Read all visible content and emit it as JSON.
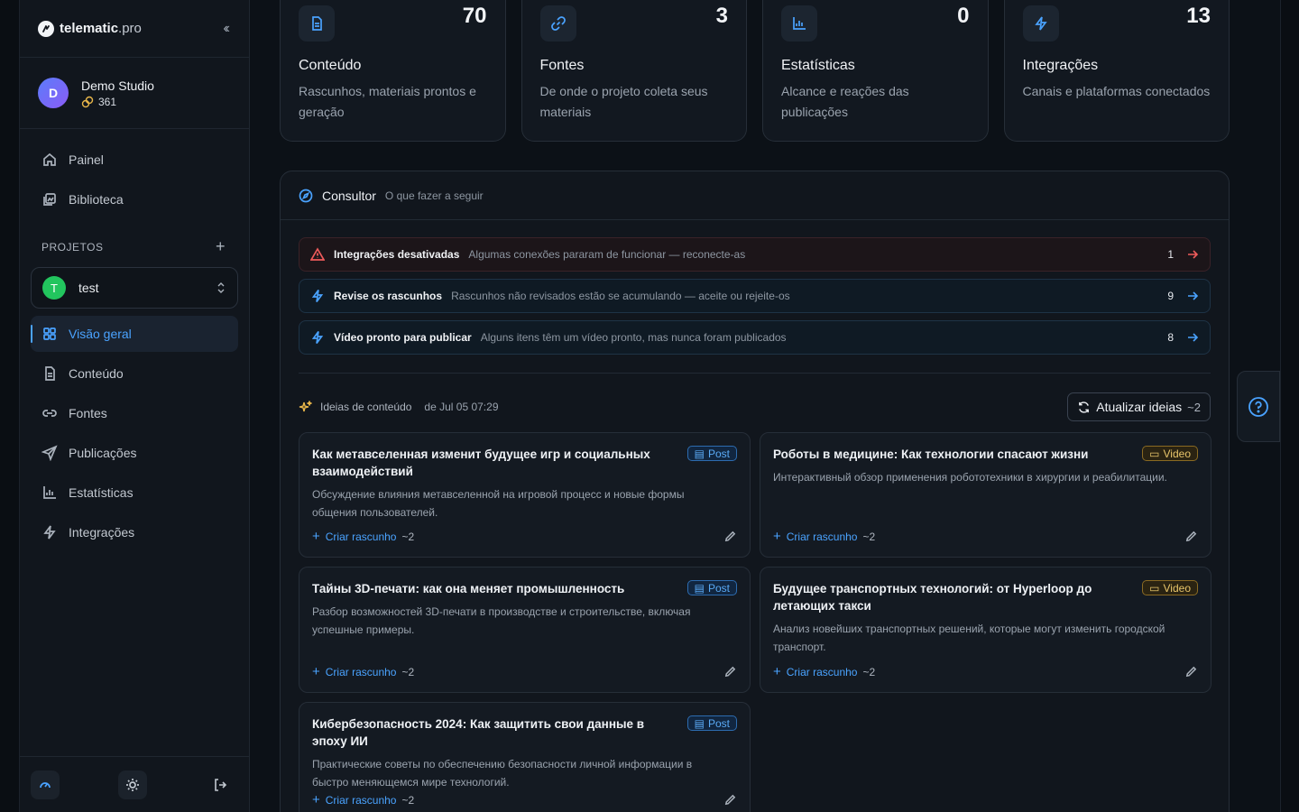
{
  "brand": {
    "name": "telematic",
    "suffix": ".pro"
  },
  "account": {
    "initial": "D",
    "name": "Demo Studio",
    "credits": "361"
  },
  "nav": {
    "top": [
      {
        "label": "Painel",
        "icon": "home-icon"
      },
      {
        "label": "Biblioteca",
        "icon": "library-icon"
      }
    ],
    "projects_label": "PROJETOS",
    "project": {
      "initial": "T",
      "name": "test"
    },
    "project_items": [
      {
        "label": "Visão geral",
        "icon": "grid-icon",
        "active": true
      },
      {
        "label": "Conteúdo",
        "icon": "document-icon"
      },
      {
        "label": "Fontes",
        "icon": "link-icon"
      },
      {
        "label": "Publicações",
        "icon": "send-icon"
      },
      {
        "label": "Estatísticas",
        "icon": "chart-icon"
      },
      {
        "label": "Integrações",
        "icon": "bolt-icon"
      }
    ]
  },
  "stats": [
    {
      "value": "70",
      "title": "Conteúdo",
      "desc": "Rascunhos, materiais prontos e geração",
      "icon": "document-icon"
    },
    {
      "value": "3",
      "title": "Fontes",
      "desc": "De onde o projeto coleta seus materiais",
      "icon": "link-icon"
    },
    {
      "value": "0",
      "title": "Estatísticas",
      "desc": "Alcance e reações das publicações",
      "icon": "chart-icon"
    },
    {
      "value": "13",
      "title": "Integrações",
      "desc": "Canais e plataformas conectados",
      "icon": "bolt-icon"
    }
  ],
  "consultor": {
    "title": "Consultor",
    "subtitle": "O que fazer a seguir",
    "alerts": [
      {
        "title": "Integrações desativadas",
        "desc": "Algumas conexões pararam de funcionar — reconecte-as",
        "count": "1",
        "kind": "warn"
      },
      {
        "title": "Revise os rascunhos",
        "desc": "Rascunhos não revisados estão se acumulando — aceite ou rejeite-os",
        "count": "9",
        "kind": "info"
      },
      {
        "title": "Vídeo pronto para publicar",
        "desc": "Alguns itens têm um vídeo pronto, mas nunca foram publicados",
        "count": "8",
        "kind": "info"
      }
    ]
  },
  "ideas": {
    "label": "Ideias de conteúdo",
    "date": "de Jul 05 07:29",
    "refresh_label": "Atualizar ideias",
    "refresh_cost": "~2",
    "create_label": "Criar rascunho",
    "create_cost": "~2",
    "cards": [
      {
        "title": "Как метавселенная изменит будущее игр и социальных взаимодействий",
        "desc": "Обсуждение влияния метавселенной на игровой процесс и новые формы общения пользователей.",
        "badge": "Post"
      },
      {
        "title": "Роботы в медицине: Как технологии спасают жизни",
        "desc": "Интерактивный обзор применения робототехники в хирургии и реабилитации.",
        "badge": "Video"
      },
      {
        "title": "Тайны 3D-печати: как она меняет промышленность",
        "desc": "Разбор возможностей 3D-печати в производстве и строительстве, включая успешные примеры.",
        "badge": "Post"
      },
      {
        "title": "Будущее транспортных технологий: от Hyperloop до летающих такси",
        "desc": "Анализ новейших транспортных решений, которые могут изменить городской транспорт.",
        "badge": "Video"
      },
      {
        "title": "Кибербезопасность 2024: Как защитить свои данные в эпоху ИИ",
        "desc": "Практические советы по обеспечению безопасности личной информации в быстро меняющемся мире технологий.",
        "badge": "Post"
      }
    ]
  },
  "colors": {
    "accent": "#4aa3ff",
    "warning": "#ef5b5b",
    "video": "#e8c56a",
    "project": "#22c55e"
  }
}
